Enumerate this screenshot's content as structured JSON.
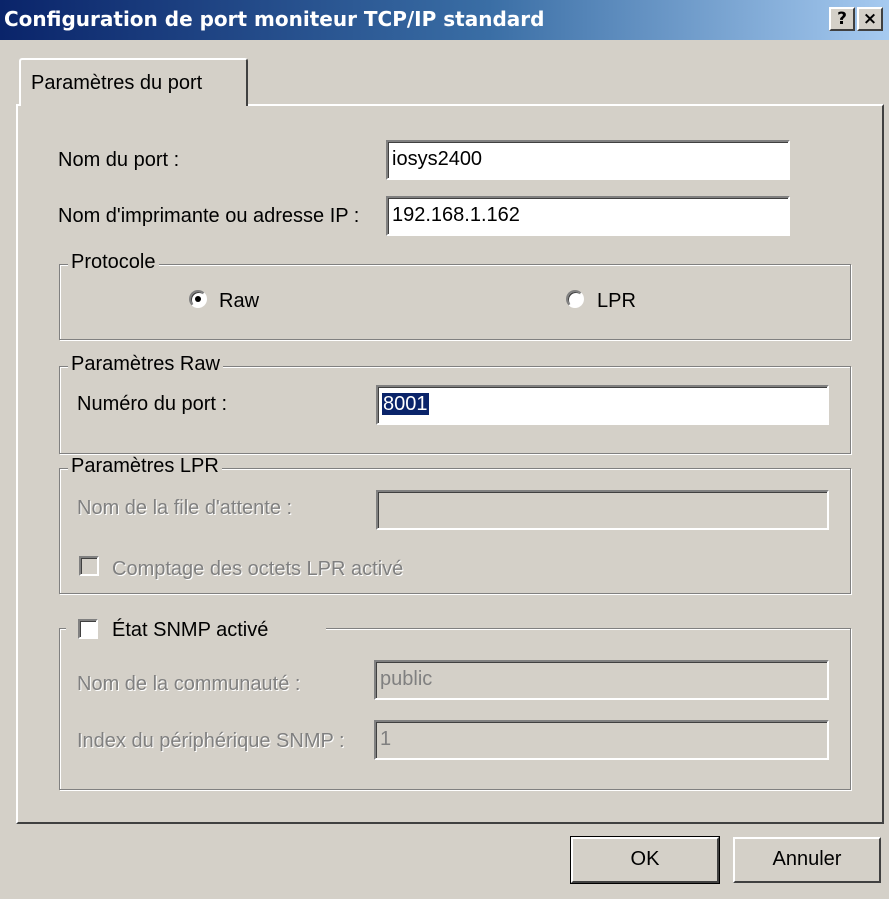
{
  "window": {
    "title": "Configuration de port moniteur TCP/IP standard",
    "help_label": "?",
    "close_label": "×"
  },
  "tab": {
    "label": "Paramètres du port"
  },
  "port_name": {
    "label": "Nom du port :",
    "value": "iosys2400"
  },
  "printer_address": {
    "label": "Nom d'imprimante ou adresse IP :",
    "value": "192.168.1.162"
  },
  "protocol": {
    "legend": "Protocole",
    "options": [
      {
        "label": "Raw",
        "selected": true
      },
      {
        "label": "LPR",
        "selected": false
      }
    ]
  },
  "raw_settings": {
    "legend": "Paramètres Raw",
    "port_number_label": "Numéro du port :",
    "port_number_value": "8001"
  },
  "lpr_settings": {
    "legend": "Paramètres LPR",
    "queue_name_label": "Nom de la file d'attente :",
    "queue_name_value": "",
    "byte_count_label": "Comptage des octets LPR activé",
    "byte_count_checked": false
  },
  "snmp": {
    "enable_label": "État SNMP activé",
    "enabled": false,
    "community_label": "Nom de la communauté :",
    "community_value": "public",
    "device_index_label": "Index du périphérique SNMP :",
    "device_index_value": "1"
  },
  "buttons": {
    "ok": "OK",
    "cancel": "Annuler"
  },
  "colors": {
    "title_gradient_start": "#0a246a",
    "title_gradient_end": "#a6caf0",
    "face": "#d4d0c8",
    "selection": "#0a246a",
    "disabled_text": "#808080"
  }
}
